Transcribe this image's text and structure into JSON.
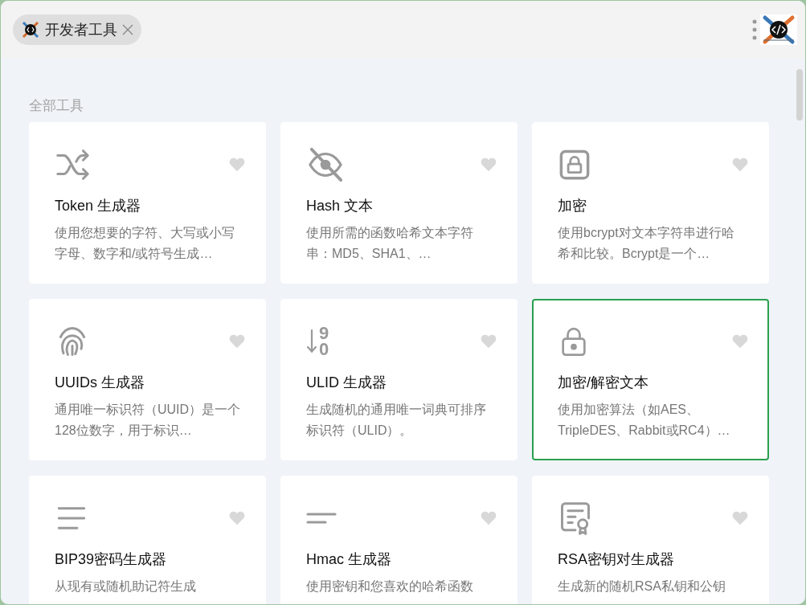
{
  "tab": {
    "label": "开发者工具",
    "selected": true
  },
  "section_title": "全部工具",
  "sort_icon_digits": [
    "9",
    "0"
  ],
  "tools": [
    {
      "title": "Token 生成器",
      "description": "使用您想要的字符、大写或小写字母、数字和/或符号生成…",
      "favorite": false,
      "selected": false
    },
    {
      "title": "Hash 文本",
      "description": "使用所需的函数哈希文本字符串：MD5、SHA1、…",
      "favorite": false,
      "selected": false
    },
    {
      "title": "加密",
      "description": "使用bcrypt对文本字符串进行哈希和比较。Bcrypt是一个…",
      "favorite": false,
      "selected": false
    },
    {
      "title": "UUIDs 生成器",
      "description": "通用唯一标识符（UUID）是一个128位数字，用于标识…",
      "favorite": false,
      "selected": false
    },
    {
      "title": "ULID 生成器",
      "description": "生成随机的通用唯一词典可排序标识符（ULID）。",
      "favorite": false,
      "selected": false
    },
    {
      "title": "加密/解密文本",
      "description": "使用加密算法（如AES、TripleDES、Rabbit或RC4）…",
      "favorite": false,
      "selected": true
    },
    {
      "title": "BIP39密码生成器",
      "description": "从现有或随机助记符生成",
      "favorite": false,
      "selected": false
    },
    {
      "title": "Hmac 生成器",
      "description": "使用密钥和您喜欢的哈希函数",
      "favorite": false,
      "selected": false
    },
    {
      "title": "RSA密钥对生成器",
      "description": "生成新的随机RSA私钥和公钥",
      "favorite": false,
      "selected": false
    }
  ]
}
